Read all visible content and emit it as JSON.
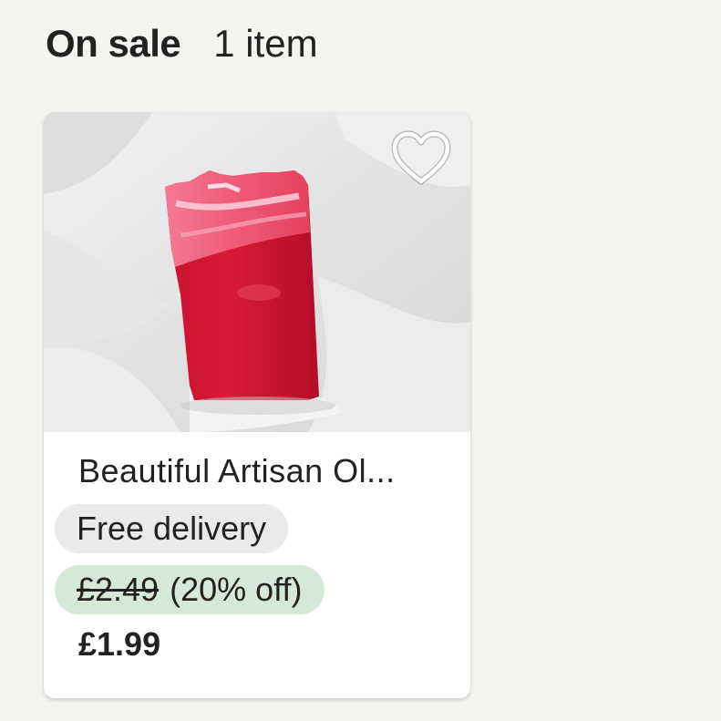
{
  "section": {
    "title": "On sale",
    "count": "1 item"
  },
  "listing": {
    "title": "Beautiful Artisan Ol...",
    "delivery_badge": "Free delivery",
    "original_price": "£2.49",
    "discount": "(20% off)",
    "price": "£1.99",
    "favorite_icon": "heart-outline-icon",
    "image_alt": "red soap bar on white fabric"
  },
  "colors": {
    "background": "#f5f4f1",
    "delivery_badge_bg": "#eaeaea",
    "discount_badge_bg": "#d4e9d7",
    "text": "#222222"
  }
}
